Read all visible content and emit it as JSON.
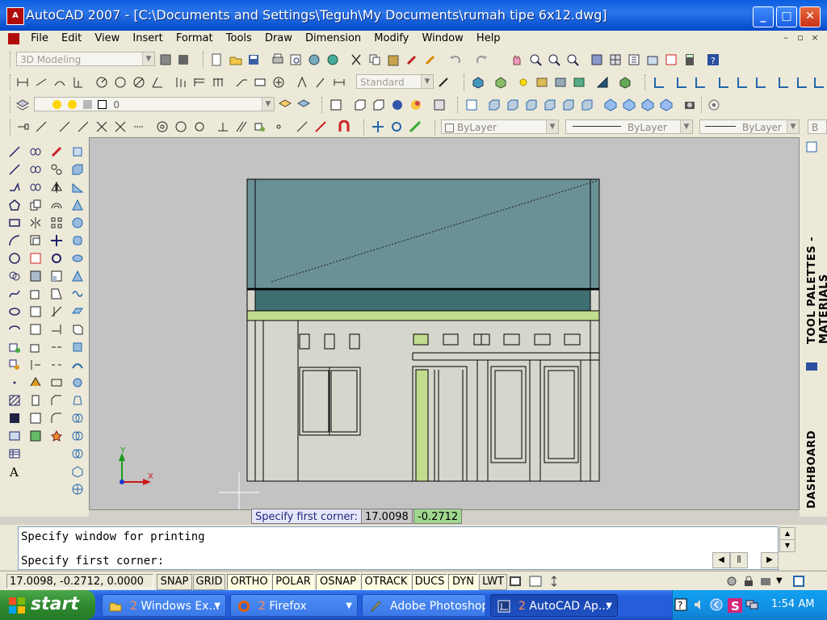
{
  "window": {
    "title": "AutoCAD 2007 - [C:\\Documents and Settings\\Teguh\\My Documents\\rumah tipe 6x12.dwg]",
    "minimize": "_",
    "maximize": "□",
    "close": "✕"
  },
  "menu": {
    "items": [
      "File",
      "Edit",
      "View",
      "Insert",
      "Format",
      "Tools",
      "Draw",
      "Dimension",
      "Modify",
      "Window",
      "Help"
    ]
  },
  "toolbars": {
    "workspace": "3D Modeling",
    "text_style": "Standard",
    "layer": "0",
    "color": "ByLayer",
    "linetype": "ByLayer",
    "lineweight": "ByLayer",
    "plotstyle": "B"
  },
  "palettes": {
    "tool_palettes": "TOOL PALETTES - MATERIALS",
    "dashboard": "DASHBOARD"
  },
  "ucs": {
    "x": "X",
    "y": "Y"
  },
  "dynamic_input": {
    "prompt": "Specify first corner:",
    "x_value": "17.0098",
    "y_value": "-0.2712"
  },
  "command_line": {
    "line1": "Specify window for printing",
    "line2": "Specify first corner:"
  },
  "status": {
    "coordinates": "17.0098, -0.2712, 0.0000",
    "buttons": [
      "SNAP",
      "GRID",
      "ORTHO",
      "POLAR",
      "OSNAP",
      "OTRACK",
      "DUCS",
      "DYN",
      "LWT"
    ]
  },
  "taskbar": {
    "start": "start",
    "tasks": [
      {
        "count": "2",
        "label": "Windows Ex..."
      },
      {
        "count": "2",
        "label": "Firefox"
      },
      {
        "count": "",
        "label": "Adobe Photoshop"
      },
      {
        "count": "2",
        "label": "AutoCAD Ap..."
      }
    ],
    "clock": "1:54 AM"
  },
  "colors": {
    "roof": "#6a9196",
    "fascia": "#3f6e73",
    "green_strip": "#c1dc8e",
    "wall": "#d6d6cc",
    "canvas": "#c3c3c3"
  }
}
